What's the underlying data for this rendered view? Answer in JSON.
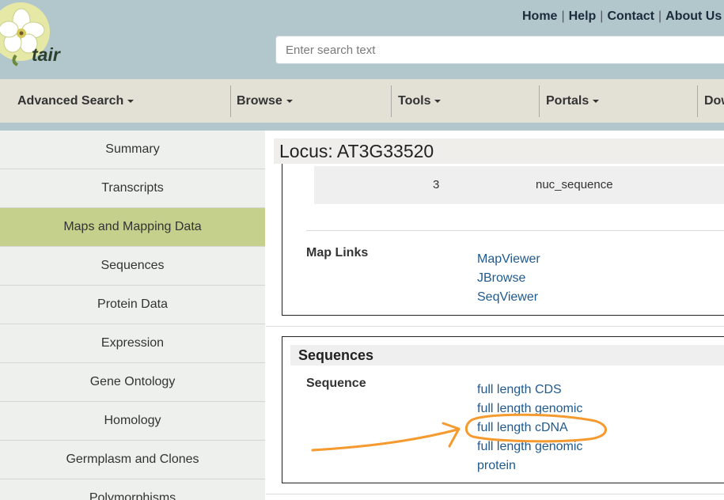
{
  "header": {
    "logo_text": "tair",
    "top_links": [
      "Home",
      "Help",
      "Contact",
      "About Us"
    ],
    "search_placeholder": "Enter search text"
  },
  "nav": {
    "items": [
      "Advanced Search",
      "Browse",
      "Tools",
      "Portals",
      "Dow"
    ]
  },
  "sidebar": {
    "items": [
      {
        "label": "Summary",
        "active": false
      },
      {
        "label": "Transcripts",
        "active": false
      },
      {
        "label": "Maps and Mapping Data",
        "active": true
      },
      {
        "label": "Sequences",
        "active": false
      },
      {
        "label": "Protein Data",
        "active": false
      },
      {
        "label": "Expression",
        "active": false
      },
      {
        "label": "Gene Ontology",
        "active": false
      },
      {
        "label": "Homology",
        "active": false
      },
      {
        "label": "Germplasm and Clones",
        "active": false
      },
      {
        "label": "Polymorphisms",
        "active": false
      }
    ]
  },
  "main": {
    "locus_title": "Locus: AT3G33520",
    "map_row": {
      "number": "3",
      "type": "nuc_sequence"
    },
    "map_links": {
      "label": "Map Links",
      "links": [
        "MapViewer",
        "JBrowse",
        "SeqViewer"
      ]
    },
    "sequences": {
      "header": "Sequences",
      "label": "Sequence",
      "links": [
        "full length CDS",
        "full length genomic",
        "full length cDNA",
        "full length genomic",
        "protein"
      ],
      "highlighted": "full length cDNA"
    }
  },
  "colors": {
    "header_bg": "#b2c7cc",
    "nav_bg": "#e3e0d6",
    "sidebar_active": "#c5d08c",
    "link": "#1f5a8f",
    "annotation": "#f59a2e"
  }
}
